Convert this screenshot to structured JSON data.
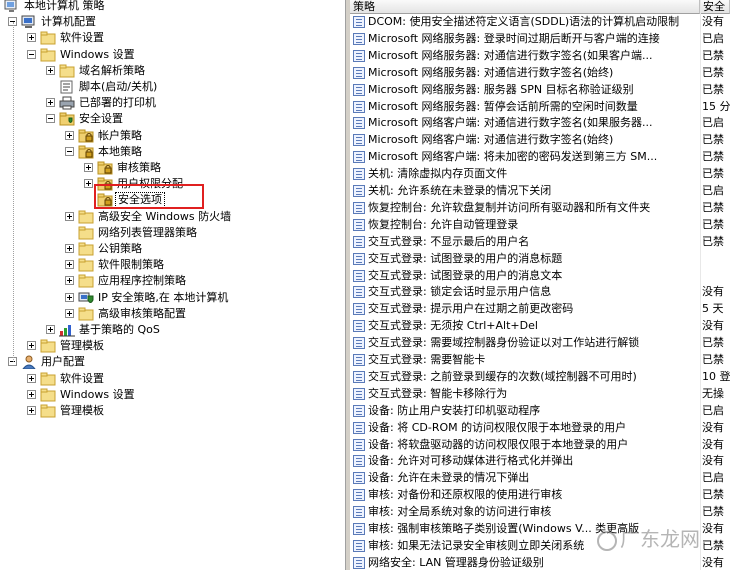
{
  "tree": [
    {
      "label": "本地计算机 策略",
      "indent": 0,
      "expander": "none",
      "icon": "computer-policy-icon"
    },
    {
      "label": "计算机配置",
      "indent": 1,
      "expander": "minus",
      "icon": "computer-icon"
    },
    {
      "label": "软件设置",
      "indent": 2,
      "expander": "plus",
      "icon": "folder-icon"
    },
    {
      "label": "Windows 设置",
      "indent": 2,
      "expander": "minus",
      "icon": "folder-icon"
    },
    {
      "label": "域名解析策略",
      "indent": 3,
      "expander": "plus",
      "icon": "folder-icon"
    },
    {
      "label": "脚本(启动/关机)",
      "indent": 3,
      "expander": "none",
      "icon": "script-icon"
    },
    {
      "label": "已部署的打印机",
      "indent": 3,
      "expander": "plus",
      "icon": "printer-icon"
    },
    {
      "label": "安全设置",
      "indent": 3,
      "expander": "minus",
      "icon": "security-icon"
    },
    {
      "label": "帐户策略",
      "indent": 4,
      "expander": "plus",
      "icon": "folder-lock-icon"
    },
    {
      "label": "本地策略",
      "indent": 4,
      "expander": "minus",
      "icon": "folder-lock-icon"
    },
    {
      "label": "审核策略",
      "indent": 5,
      "expander": "plus",
      "icon": "folder-lock-icon"
    },
    {
      "label": "用户权限分配",
      "indent": 5,
      "expander": "plus",
      "icon": "folder-lock-icon"
    },
    {
      "label": "安全选项",
      "indent": 5,
      "expander": "none",
      "icon": "folder-lock-icon",
      "selected": true
    },
    {
      "label": "高级安全 Windows 防火墙",
      "indent": 4,
      "expander": "plus",
      "icon": "folder-icon"
    },
    {
      "label": "网络列表管理器策略",
      "indent": 4,
      "expander": "none",
      "icon": "folder-icon"
    },
    {
      "label": "公钥策略",
      "indent": 4,
      "expander": "plus",
      "icon": "folder-icon"
    },
    {
      "label": "软件限制策略",
      "indent": 4,
      "expander": "plus",
      "icon": "folder-icon"
    },
    {
      "label": "应用程序控制策略",
      "indent": 4,
      "expander": "plus",
      "icon": "folder-icon"
    },
    {
      "label": "IP 安全策略,在 本地计算机",
      "indent": 4,
      "expander": "plus",
      "icon": "ip-security-icon"
    },
    {
      "label": "高级审核策略配置",
      "indent": 4,
      "expander": "plus",
      "icon": "folder-icon"
    },
    {
      "label": "基于策略的 QoS",
      "indent": 3,
      "expander": "plus",
      "icon": "qos-chart-icon"
    },
    {
      "label": "管理模板",
      "indent": 2,
      "expander": "plus",
      "icon": "folder-icon"
    },
    {
      "label": "用户配置",
      "indent": 1,
      "expander": "minus",
      "icon": "user-icon"
    },
    {
      "label": "软件设置",
      "indent": 2,
      "expander": "plus",
      "icon": "folder-icon"
    },
    {
      "label": "Windows 设置",
      "indent": 2,
      "expander": "plus",
      "icon": "folder-icon"
    },
    {
      "label": "管理模板",
      "indent": 2,
      "expander": "plus",
      "icon": "folder-icon"
    }
  ],
  "list": {
    "columns": [
      "策略",
      "安全"
    ],
    "rows": [
      {
        "policy": "DCOM: 使用安全描述符定义语言(SDDL)语法的计算机启动限制",
        "value": "没有"
      },
      {
        "policy": "Microsoft 网络服务器: 登录时间过期后断开与客户端的连接",
        "value": "已启"
      },
      {
        "policy": "Microsoft 网络服务器: 对通信进行数字签名(如果客户端...",
        "value": "已禁"
      },
      {
        "policy": "Microsoft 网络服务器: 对通信进行数字签名(始终)",
        "value": "已禁"
      },
      {
        "policy": "Microsoft 网络服务器: 服务器 SPN 目标名称验证级别",
        "value": "已禁"
      },
      {
        "policy": "Microsoft 网络服务器: 暂停会话前所需的空闲时间数量",
        "value": "15 分"
      },
      {
        "policy": "Microsoft 网络客户端: 对通信进行数字签名(如果服务器...",
        "value": "已启"
      },
      {
        "policy": "Microsoft 网络客户端: 对通信进行数字签名(始终)",
        "value": "已禁"
      },
      {
        "policy": "Microsoft 网络客户端: 将未加密的密码发送到第三方 SM...",
        "value": "已禁"
      },
      {
        "policy": "关机: 清除虚拟内存页面文件",
        "value": "已禁"
      },
      {
        "policy": "关机: 允许系统在未登录的情况下关闭",
        "value": "已启"
      },
      {
        "policy": "恢复控制台: 允许软盘复制并访问所有驱动器和所有文件夹",
        "value": "已禁"
      },
      {
        "policy": "恢复控制台: 允许自动管理登录",
        "value": "已禁"
      },
      {
        "policy": "交互式登录: 不显示最后的用户名",
        "value": "已禁"
      },
      {
        "policy": "交互式登录: 试图登录的用户的消息标题",
        "value": ""
      },
      {
        "policy": "交互式登录: 试图登录的用户的消息文本",
        "value": ""
      },
      {
        "policy": "交互式登录: 锁定会话时显示用户信息",
        "value": "没有"
      },
      {
        "policy": "交互式登录: 提示用户在过期之前更改密码",
        "value": "5 天"
      },
      {
        "policy": "交互式登录: 无须按 Ctrl+Alt+Del",
        "value": "没有"
      },
      {
        "policy": "交互式登录: 需要域控制器身份验证以对工作站进行解锁",
        "value": "已禁"
      },
      {
        "policy": "交互式登录: 需要智能卡",
        "value": "已禁"
      },
      {
        "policy": "交互式登录: 之前登录到缓存的次数(域控制器不可用时)",
        "value": "10 登"
      },
      {
        "policy": "交互式登录: 智能卡移除行为",
        "value": "无操"
      },
      {
        "policy": "设备: 防止用户安装打印机驱动程序",
        "value": "已启"
      },
      {
        "policy": "设备: 将 CD-ROM 的访问权限仅限于本地登录的用户",
        "value": "没有"
      },
      {
        "policy": "设备: 将软盘驱动器的访问权限仅限于本地登录的用户",
        "value": "没有"
      },
      {
        "policy": "设备: 允许对可移动媒体进行格式化并弹出",
        "value": "没有"
      },
      {
        "policy": "设备: 允许在未登录的情况下弹出",
        "value": "已启"
      },
      {
        "policy": "审核: 对备份和还原权限的使用进行审核",
        "value": "已禁"
      },
      {
        "policy": "审核: 对全局系统对象的访问进行审核",
        "value": "已禁"
      },
      {
        "policy": "审核: 强制审核策略子类别设置(Windows V... 类更高版",
        "value": "没有"
      },
      {
        "policy": "审核: 如果无法记录安全审核则立即关闭系统",
        "value": "已禁"
      },
      {
        "policy": "网络安全: LAN 管理器身份验证级别",
        "value": "没有"
      }
    ]
  },
  "watermark": {
    "text": "广东龙网"
  }
}
